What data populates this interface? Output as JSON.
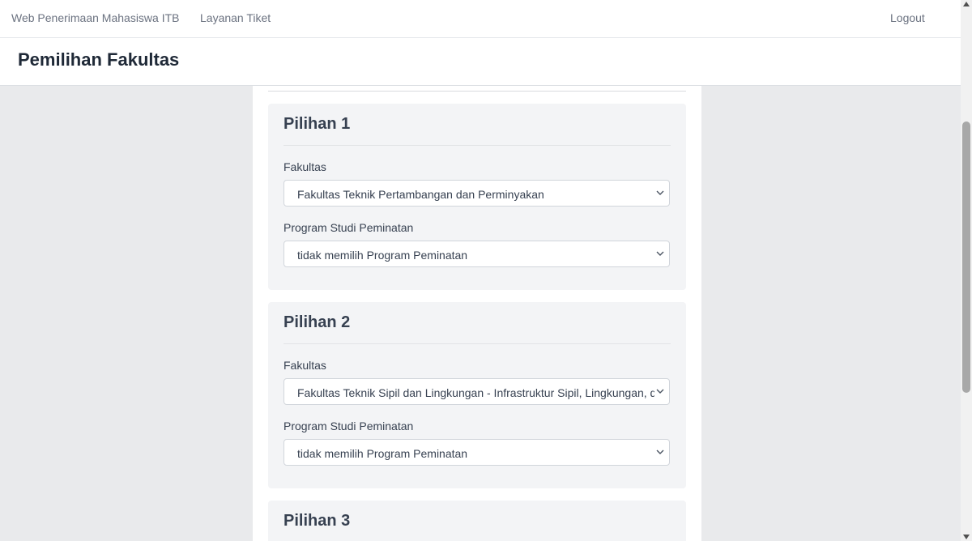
{
  "nav": {
    "brand": "Web Penerimaan Mahasiswa ITB",
    "tiket": "Layanan Tiket",
    "logout": "Logout"
  },
  "page": {
    "title": "Pemilihan Fakultas"
  },
  "choices": [
    {
      "title": "Pilihan 1",
      "fakultas_label": "Fakultas",
      "fakultas_value": "Fakultas Teknik Pertambangan dan Perminyakan",
      "prodi_label": "Program Studi Peminatan",
      "prodi_value": "tidak memilih Program Peminatan"
    },
    {
      "title": "Pilihan 2",
      "fakultas_label": "Fakultas",
      "fakultas_value": "Fakultas Teknik Sipil dan Lingkungan - Infrastruktur Sipil, Lingkungan, dan Kelautan",
      "prodi_label": "Program Studi Peminatan",
      "prodi_value": "tidak memilih Program Peminatan"
    },
    {
      "title": "Pilihan 3"
    }
  ],
  "icons": {
    "dropdown": "chevron-down-icon"
  },
  "colors": {
    "background": "#e9eaec",
    "card": "#f3f4f6",
    "title": "#1f2937"
  }
}
